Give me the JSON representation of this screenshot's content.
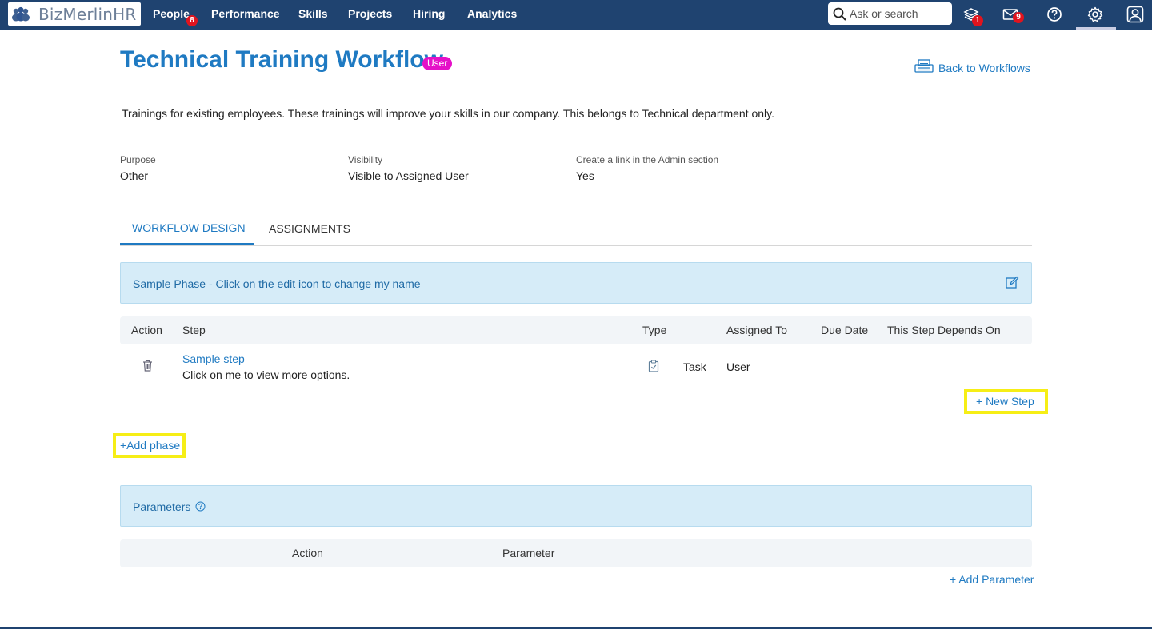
{
  "nav": {
    "logo_text": "BizMerlinHR",
    "items": [
      {
        "label": "People",
        "badge": "8"
      },
      {
        "label": "Performance"
      },
      {
        "label": "Skills"
      },
      {
        "label": "Projects"
      },
      {
        "label": "Hiring"
      },
      {
        "label": "Analytics"
      }
    ],
    "search_placeholder": "Ask or search",
    "notifications_badge": "1",
    "messages_badge": "9",
    "colors": {
      "bar": "#1f4370",
      "badge": "#e0141e"
    },
    "icons": [
      "search-icon",
      "stack-icon",
      "mail-icon",
      "help-icon",
      "gear-icon",
      "profile-icon"
    ]
  },
  "page": {
    "title": "Technical Training Workflow",
    "role_badge": "User",
    "back_link": "Back to Workflows",
    "description": "Trainings for existing employees. These trainings will improve your skills in our company. This belongs to Technical department only.",
    "meta": [
      {
        "label": "Purpose",
        "value": "Other"
      },
      {
        "label": "Visibility",
        "value": "Visible to Assigned User"
      },
      {
        "label": "Create a link in the Admin section",
        "value": "Yes"
      }
    ],
    "tabs": [
      {
        "label": "WORKFLOW DESIGN",
        "active": true
      },
      {
        "label": "ASSIGNMENTS",
        "active": false
      }
    ]
  },
  "phase": {
    "name": "Sample Phase - Click on the edit icon to change my name",
    "columns": [
      "Action",
      "Step",
      "Type",
      "Assigned To",
      "Due Date",
      "This Step Depends On"
    ],
    "steps": [
      {
        "name": "Sample step",
        "hint": "Click on me to view more options.",
        "type": "Task",
        "assigned_to": "User",
        "due_date": "",
        "depends_on": ""
      }
    ],
    "new_step": "+ New Step"
  },
  "add_phase": "+Add phase",
  "parameters": {
    "title": "Parameters",
    "columns": [
      "Action",
      "Parameter"
    ],
    "add_parameter": "+ Add Parameter"
  },
  "colors": {
    "accent": "#1f7ac2",
    "role_badge": "#e510c8",
    "highlight": "#f6ee16",
    "phase_bg": "#d6ecf8"
  }
}
